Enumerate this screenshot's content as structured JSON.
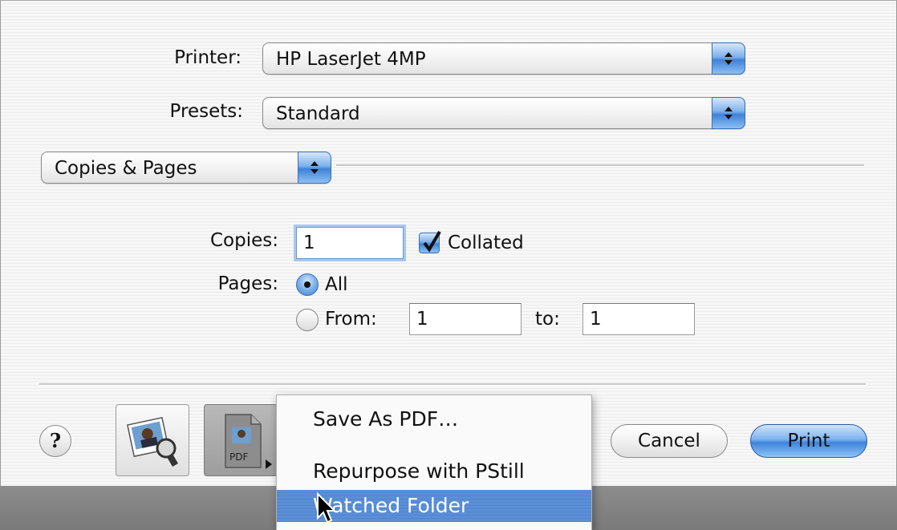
{
  "printer": {
    "label": "Printer:",
    "value": "HP LaserJet 4MP"
  },
  "presets": {
    "label": "Presets:",
    "value": "Standard"
  },
  "panel": {
    "value": "Copies & Pages"
  },
  "copies": {
    "label": "Copies:",
    "value": "1",
    "collated_label": "Collated",
    "collated": true
  },
  "pages": {
    "label": "Pages:",
    "all_label": "All",
    "from_label": "From:",
    "from_value": "1",
    "to_label": "to:",
    "to_value": "1",
    "selected": "All"
  },
  "buttons": {
    "help": "?",
    "cancel": "Cancel",
    "print": "Print",
    "pdf_icon_text": "PDF"
  },
  "menu": {
    "items": [
      "Save As PDF…",
      "Repurpose with PStill",
      "Watched Folder"
    ],
    "highlighted": "Watched Folder"
  },
  "colors": {
    "accent": "#3f82d8",
    "highlight": "#5b8fd6"
  }
}
